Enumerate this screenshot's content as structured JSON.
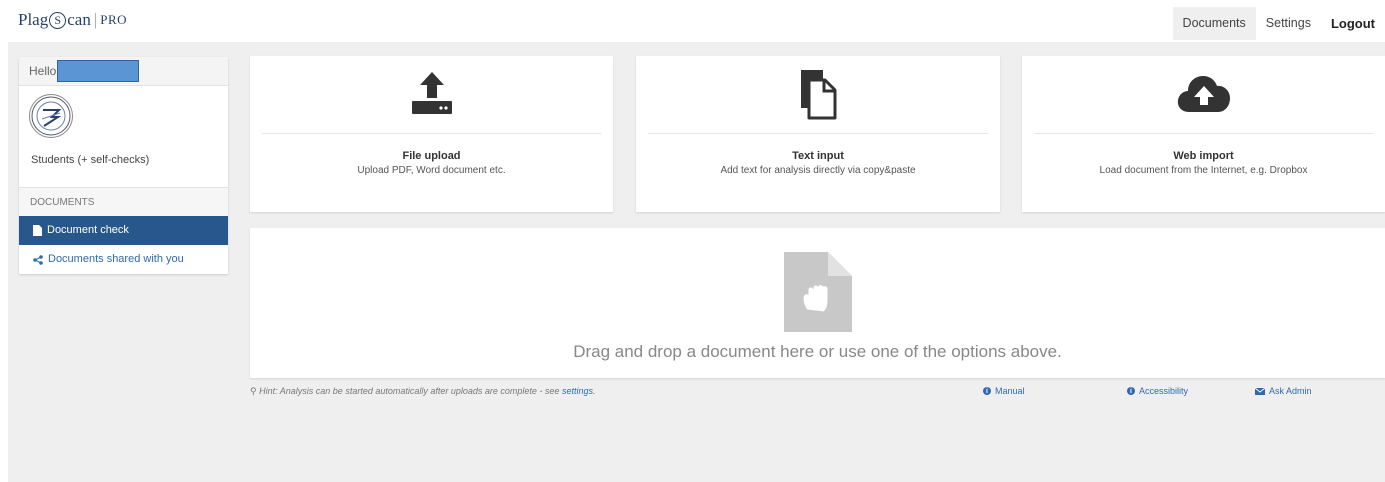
{
  "header": {
    "logo": {
      "part1": "Plag",
      "s_letter": "S",
      "part2": "can",
      "separator": "|",
      "suffix": "PRO"
    },
    "nav": [
      {
        "label": "Documents",
        "active": true
      },
      {
        "label": "Settings",
        "active": false
      },
      {
        "label": "Logout",
        "active": false
      }
    ]
  },
  "sidebar": {
    "hello": "Hello",
    "org_name": "Students (+ self-checks)",
    "section_label": "DOCUMENTS",
    "items": [
      {
        "label": "Document check",
        "active": true,
        "icon": "file-icon"
      },
      {
        "label": "Documents shared with you",
        "active": false,
        "icon": "share-icon"
      }
    ]
  },
  "cards": [
    {
      "title": "File upload",
      "desc": "Upload PDF, Word document etc.",
      "icon": "upload-icon"
    },
    {
      "title": "Text input",
      "desc": "Add text for analysis directly via copy&paste",
      "icon": "copy-icon"
    },
    {
      "title": "Web import",
      "desc": "Load document from the Internet, e.g. Dropbox",
      "icon": "cloud-upload-icon"
    }
  ],
  "dropzone": {
    "text": "Drag and drop a document here or use one of the options above.",
    "icon": "document-hand-icon"
  },
  "footer": {
    "hint_prefix": "Hint: Analysis can be started automatically after uploads are complete - see ",
    "hint_link": "settings",
    "hint_suffix": ".",
    "links": [
      {
        "label": "Manual",
        "icon": "info-icon"
      },
      {
        "label": "Accessibility",
        "icon": "info-icon"
      },
      {
        "label": "Ask Admin",
        "icon": "envelope-icon"
      }
    ]
  },
  "colors": {
    "brand": "#2a3f6e",
    "active_nav": "#28588b",
    "link": "#2f6ab0",
    "background": "#efefef"
  }
}
